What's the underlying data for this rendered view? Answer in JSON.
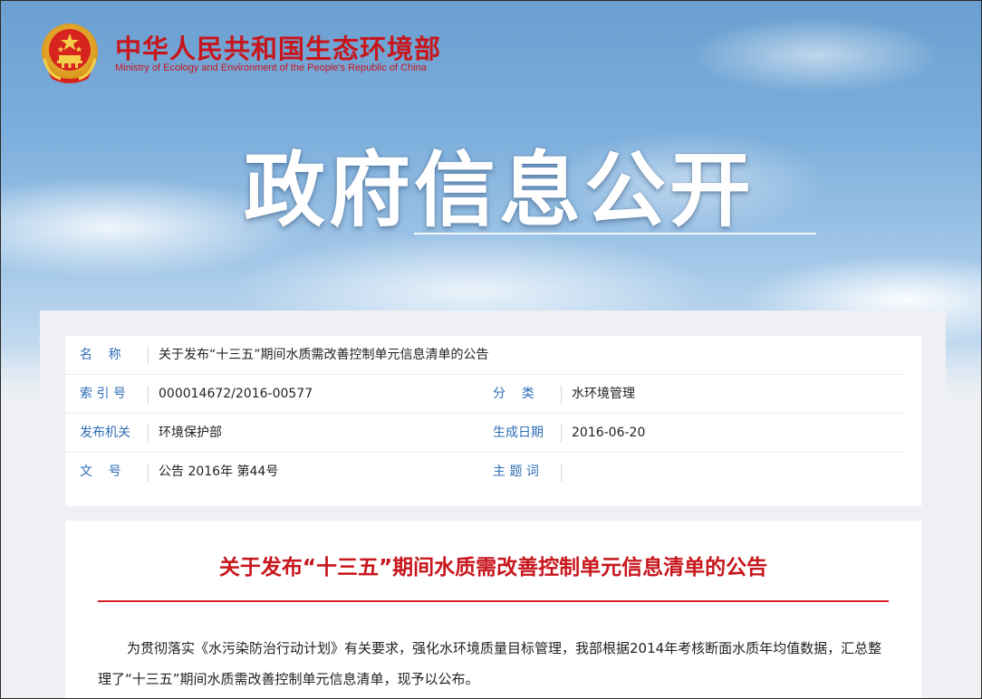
{
  "header": {
    "ministry_cn": "中华人民共和国生态环境部",
    "ministry_en": "Ministry of Ecology and Environment of the People's Republic of China",
    "hero_title": "政府信息公开",
    "brand_color": "#c8161d"
  },
  "meta": {
    "name_label": "名    称",
    "name_value": "关于发布“十三五”期间水质需改善控制单元信息清单的公告",
    "index_label": "索 引 号",
    "index_value": "000014672/2016-00577",
    "category_label": "分    类",
    "category_value": "水环境管理",
    "issuer_label": "发布机关",
    "issuer_value": "环境保护部",
    "date_label": "生成日期",
    "date_value": "2016-06-20",
    "docno_label": "文    号",
    "docno_value": "公告 2016年 第44号",
    "topic_label": "主 题 词",
    "topic_value": "",
    "label_color": "#2d6db5"
  },
  "article": {
    "title": "关于发布“十三五”期间水质需改善控制单元信息清单的公告",
    "body": "为贯彻落实《水污染防治行动计划》有关要求，强化水环境质量目标管理，我部根据2014年考核断面水质年均值数据，汇总整理了“十三五”期间水质需改善控制单元信息清单，现予以公布。",
    "title_color": "#c8161d"
  }
}
